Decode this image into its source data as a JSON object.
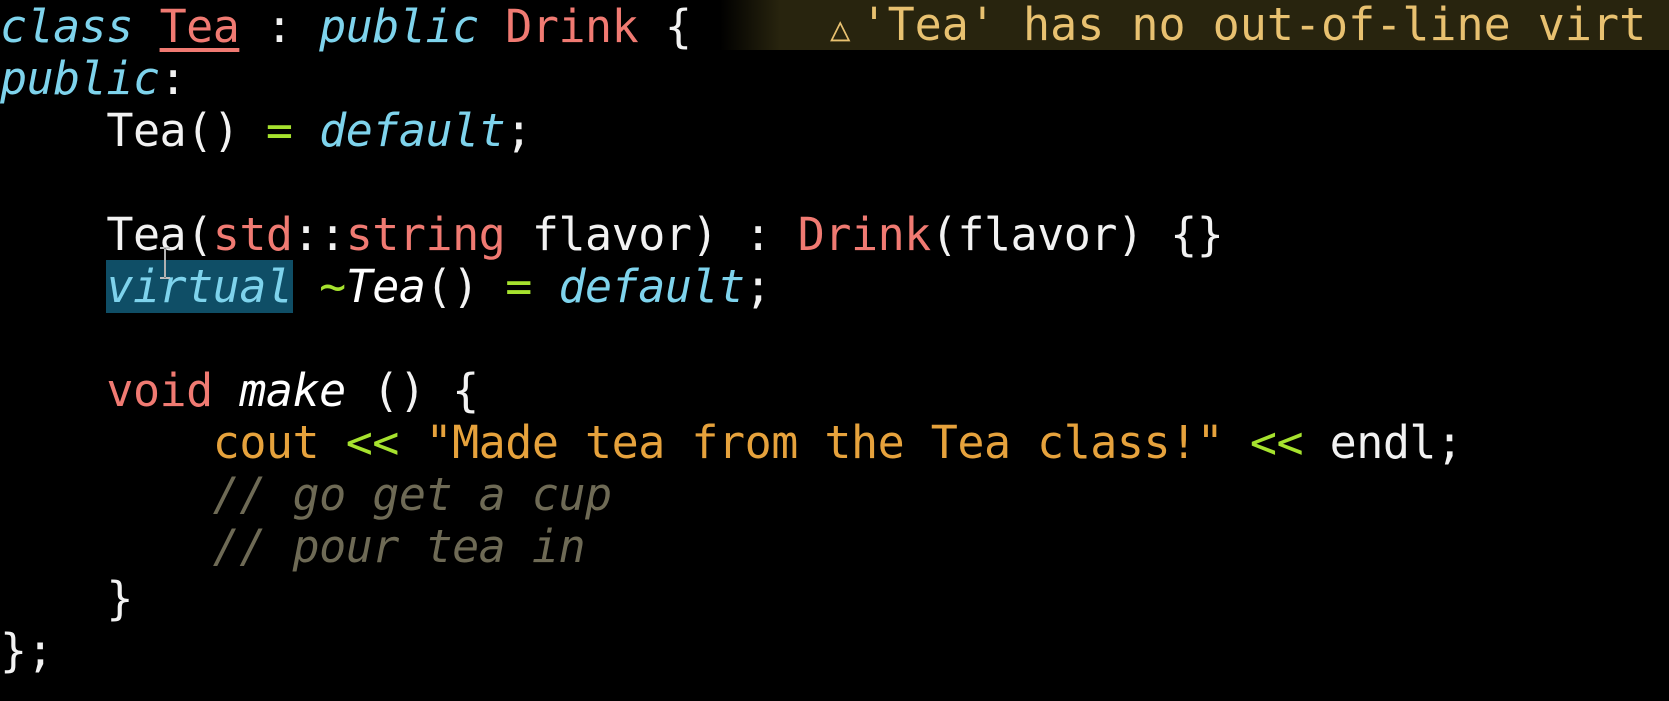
{
  "editor": {
    "lines": [
      {
        "tokens": [
          "class",
          " ",
          "Tea",
          " : ",
          "public",
          " ",
          "Drink",
          " {"
        ]
      },
      {
        "tokens": [
          "public",
          ":"
        ]
      },
      {
        "tokens": [
          "    ",
          "Tea",
          "()",
          " = ",
          "default",
          ";"
        ]
      },
      {
        "tokens": []
      },
      {
        "tokens": [
          "    ",
          "Tea",
          "(",
          "std",
          "::",
          "string",
          " flavor) : ",
          "Drink",
          "(flavor) {}"
        ]
      },
      {
        "tokens": [
          "    ",
          "virtual",
          " ",
          "~",
          "Tea",
          "()",
          " = ",
          "default",
          ";"
        ]
      },
      {
        "tokens": []
      },
      {
        "tokens": [
          "    ",
          "void",
          " ",
          "make",
          " () {"
        ]
      },
      {
        "tokens": [
          "        ",
          "cout",
          " ",
          "<<",
          " ",
          "\"Made tea from the Tea class!\"",
          " ",
          "<<",
          " endl;"
        ]
      },
      {
        "tokens": [
          "        ",
          "// go get a cup"
        ]
      },
      {
        "tokens": [
          "        ",
          "// pour tea in"
        ]
      },
      {
        "tokens": [
          "    ",
          "}"
        ]
      },
      {
        "tokens": [
          "};"
        ]
      }
    ]
  },
  "diagnostic": {
    "icon": "warning-triangle-icon",
    "glyph": "△",
    "text": "'Tea' has no out-of-line virt",
    "color": "#e8c170"
  },
  "theme": {
    "background": "#000000",
    "keyword_italic": "#7ed3ec",
    "keyword": "#f07a72",
    "operator": "#a6e22e",
    "string": "#e6a23c",
    "comment": "#6e6a55",
    "selection": "#0f4e66"
  }
}
